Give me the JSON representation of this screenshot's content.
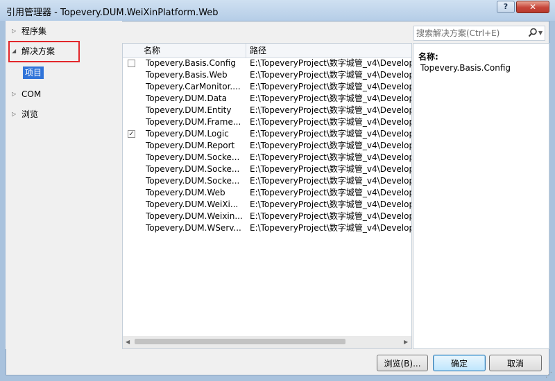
{
  "window": {
    "title": "引用管理器 - Topevery.DUM.WeiXinPlatform.Web",
    "help_label": "?",
    "close_label": "✕"
  },
  "sidebar": {
    "items": [
      {
        "label": "程序集",
        "arrow": "▷",
        "expanded": false
      },
      {
        "label": "解决方案",
        "arrow": "◢",
        "expanded": true
      },
      {
        "label": "COM",
        "arrow": "▷",
        "expanded": false
      },
      {
        "label": "浏览",
        "arrow": "▷",
        "expanded": false
      }
    ],
    "selected_sub_item": "项目"
  },
  "search": {
    "placeholder": "搜索解决方案(Ctrl+E)",
    "icon": "search-icon"
  },
  "list": {
    "columns": {
      "name": "名称",
      "path": "路径"
    },
    "rows": [
      {
        "name": "Topevery.Basis.Config",
        "path": "E:\\TopeveryProject\\数字城管_v4\\Develop",
        "checked": false,
        "checkbox_visible": true
      },
      {
        "name": "Topevery.Basis.Web",
        "path": "E:\\TopeveryProject\\数字城管_v4\\Develop",
        "checked": false,
        "checkbox_visible": false
      },
      {
        "name": "Topevery.CarMonitor....",
        "path": "E:\\TopeveryProject\\数字城管_v4\\Develop",
        "checked": false,
        "checkbox_visible": false
      },
      {
        "name": "Topevery.DUM.Data",
        "path": "E:\\TopeveryProject\\数字城管_v4\\Develop",
        "checked": false,
        "checkbox_visible": false
      },
      {
        "name": "Topevery.DUM.Entity",
        "path": "E:\\TopeveryProject\\数字城管_v4\\Develop",
        "checked": false,
        "checkbox_visible": false
      },
      {
        "name": "Topevery.DUM.Frame...",
        "path": "E:\\TopeveryProject\\数字城管_v4\\Develop",
        "checked": false,
        "checkbox_visible": false
      },
      {
        "name": "Topevery.DUM.Logic",
        "path": "E:\\TopeveryProject\\数字城管_v4\\Develop",
        "checked": true,
        "checkbox_visible": true
      },
      {
        "name": "Topevery.DUM.Report",
        "path": "E:\\TopeveryProject\\数字城管_v4\\Develop",
        "checked": false,
        "checkbox_visible": false
      },
      {
        "name": "Topevery.DUM.Socke...",
        "path": "E:\\TopeveryProject\\数字城管_v4\\Develop",
        "checked": false,
        "checkbox_visible": false
      },
      {
        "name": "Topevery.DUM.Socke...",
        "path": "E:\\TopeveryProject\\数字城管_v4\\Develop",
        "checked": false,
        "checkbox_visible": false
      },
      {
        "name": "Topevery.DUM.Socke...",
        "path": "E:\\TopeveryProject\\数字城管_v4\\Develop",
        "checked": false,
        "checkbox_visible": false
      },
      {
        "name": "Topevery.DUM.Web",
        "path": "E:\\TopeveryProject\\数字城管_v4\\Develop",
        "checked": false,
        "checkbox_visible": false
      },
      {
        "name": "Topevery.DUM.WeiXi...",
        "path": "E:\\TopeveryProject\\数字城管_v4\\Develop",
        "checked": false,
        "checkbox_visible": false
      },
      {
        "name": "Topevery.DUM.Weixin...",
        "path": "E:\\TopeveryProject\\数字城管_v4\\Develop",
        "checked": false,
        "checkbox_visible": false
      },
      {
        "name": "Topevery.DUM.WServ...",
        "path": "E:\\TopeveryProject\\数字城管_v4\\Develop",
        "checked": false,
        "checkbox_visible": false
      }
    ]
  },
  "details": {
    "label": "名称:",
    "value": "Topevery.Basis.Config"
  },
  "footer": {
    "browse_label": "浏览(B)...",
    "ok_label": "确定",
    "cancel_label": "取消"
  },
  "colors": {
    "selection": "#3074d9",
    "highlight_box": "#e2262a",
    "title_bar": "#b9d1ea"
  }
}
